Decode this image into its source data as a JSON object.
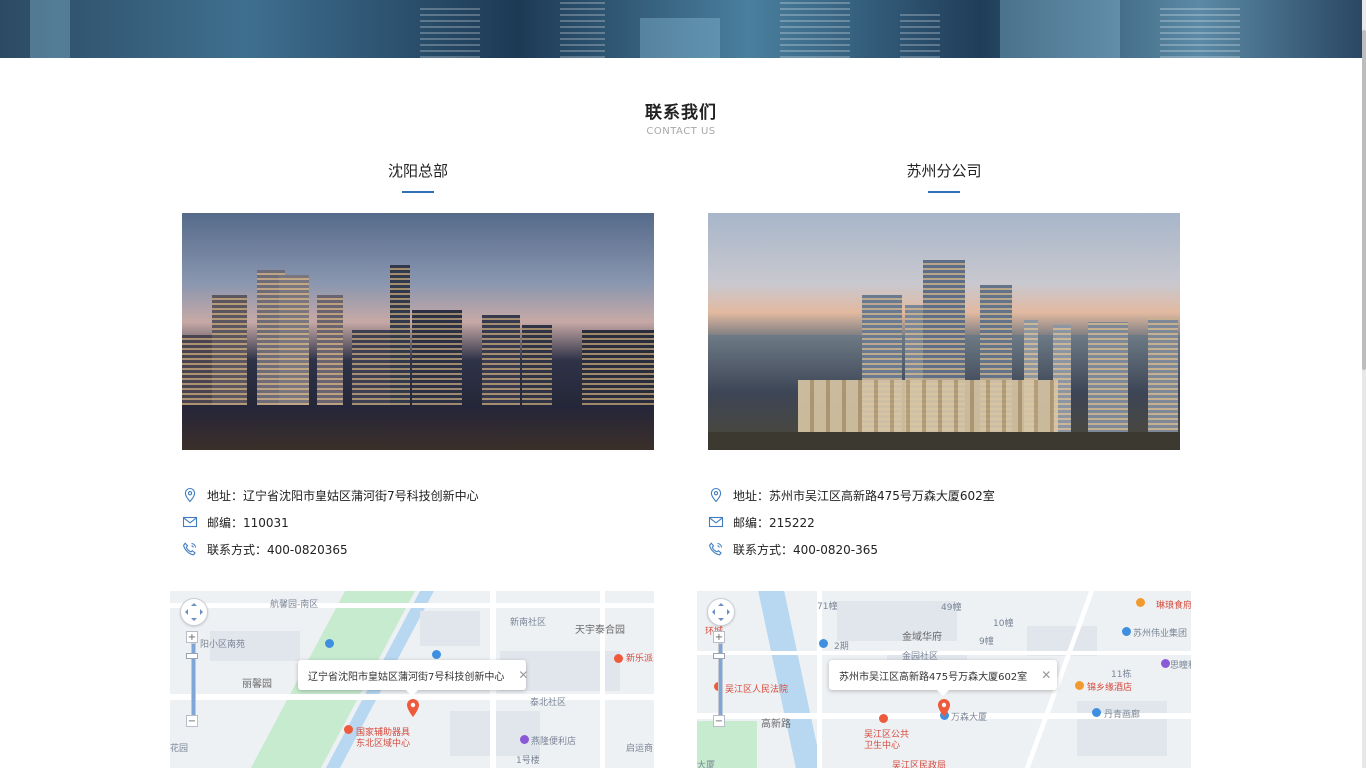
{
  "section": {
    "title": "联系我们",
    "subtitle": "CONTACT US"
  },
  "offices": [
    {
      "name": "沈阳总部",
      "address": "地址：辽宁省沈阳市皇姑区蒲河街7号科技创新中心",
      "postcode": "邮编：110031",
      "phone": "联系方式：400-0820365",
      "map": {
        "bubble": "辽宁省沈阳市皇姑区蒲河街7号科技创新中心",
        "labels": [
          "航馨园-南区",
          "新南社区",
          "天宇泰合园",
          "阳小区南苑",
          "丽馨园",
          "新乐派",
          "泰北社区",
          "国家辅助器具",
          "东北区域中心",
          "燕隆便利店",
          "启运商",
          "1号楼",
          "花园"
        ]
      }
    },
    {
      "name": "苏州分公司",
      "address": "地址：苏州市吴江区高新路475号万森大厦602室",
      "postcode": "邮编：215222",
      "phone": "联系方式：400-0820-365",
      "map": {
        "bubble": "苏州市吴江区高新路475号万森大厦602室",
        "labels": [
          "71幢",
          "49幢",
          "琳琅食府",
          "10幢",
          "金域华府",
          "9幢",
          "苏州伟业集团",
          "2期",
          "金园社区",
          "11栋",
          "思瞳科",
          "吴江区人民法院",
          "锦乡缘酒店",
          "高新路",
          "万森大厦",
          "丹青画廊",
          "吴江区公共",
          "卫生中心",
          "吴江区民政局",
          "环城",
          "大厦"
        ]
      }
    }
  ],
  "colors": {
    "accent": "#2e6fb5",
    "icon": "#3f7dc0",
    "marker": "#ee5a3c"
  },
  "icons": [
    "location-pin-icon",
    "mail-icon",
    "phone-icon",
    "map-pan-control-icon",
    "zoom-in-icon",
    "zoom-out-icon",
    "close-icon",
    "map-marker-icon"
  ]
}
